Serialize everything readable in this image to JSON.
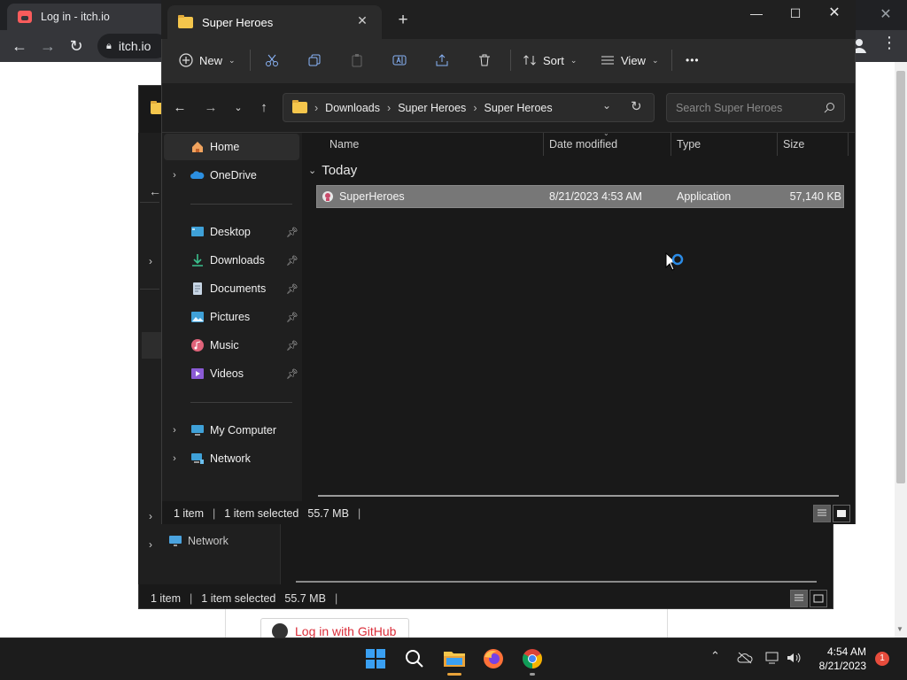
{
  "browser": {
    "tab_title": "Log in - itch.io",
    "url": "itch.io",
    "page_button": "Log in with GitHub"
  },
  "back_window": {
    "nav_network": "Network",
    "status_items": "1 item",
    "status_selected": "1 item selected",
    "status_size": "55.7 MB"
  },
  "window": {
    "tab_title": "Super Heroes",
    "toolbar": {
      "new_label": "New",
      "sort_label": "Sort",
      "view_label": "View",
      "more_label": "•••"
    },
    "breadcrumb": [
      "Downloads",
      "Super Heroes",
      "Super Heroes"
    ],
    "search_placeholder": "Search Super Heroes",
    "nav": {
      "home": "Home",
      "onedrive": "OneDrive",
      "desktop": "Desktop",
      "downloads": "Downloads",
      "documents": "Documents",
      "pictures": "Pictures",
      "music": "Music",
      "videos": "Videos",
      "my_computer": "My Computer",
      "network": "Network"
    },
    "columns": {
      "name": "Name",
      "date_modified": "Date modified",
      "type": "Type",
      "size": "Size"
    },
    "group_label": "Today",
    "files": [
      {
        "name": "SuperHeroes",
        "date_modified": "8/21/2023 4:53 AM",
        "type": "Application",
        "size": "57,140 KB"
      }
    ],
    "status": {
      "items": "1 item",
      "selected": "1 item selected",
      "size": "55.7 MB"
    }
  },
  "taskbar": {
    "time": "4:54 AM",
    "date": "8/21/2023",
    "notification_count": "1"
  },
  "colors": {
    "accent": "#0078d4",
    "explorer_bg": "#191919",
    "selection": "#777777",
    "itch_red": "#fa5c5c"
  }
}
